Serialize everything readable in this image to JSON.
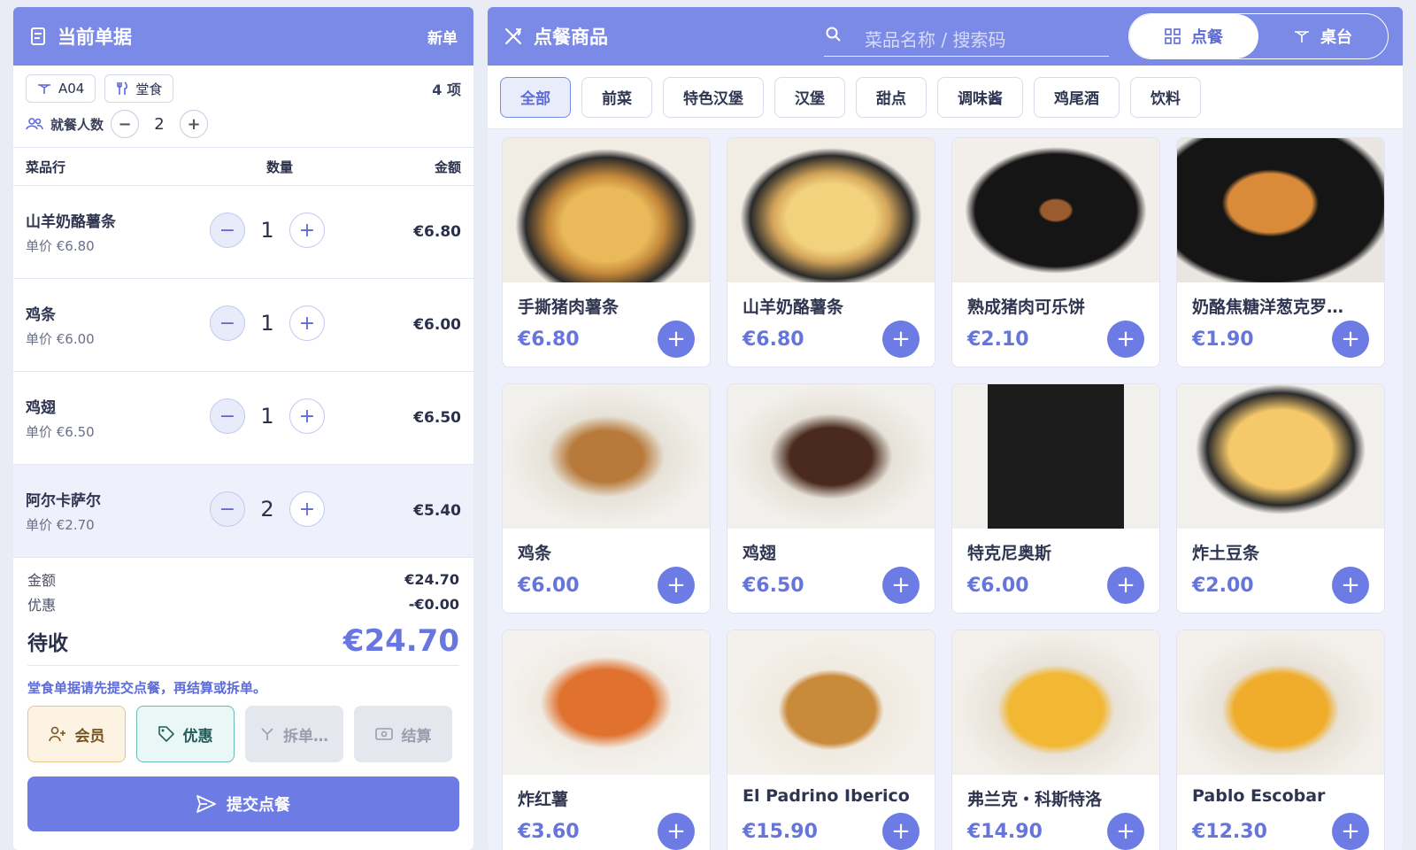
{
  "order": {
    "title": "当前单据",
    "new_label": "新单",
    "table": "A04",
    "mode": "堂食",
    "item_count": "4 项",
    "diners_label": "就餐人数",
    "diners": "2",
    "col_item": "菜品行",
    "col_qty": "数量",
    "col_amount": "金额",
    "items": [
      {
        "name": "山羊奶酪薯条",
        "unit": "单价 €6.80",
        "qty": "1",
        "amount": "€6.80"
      },
      {
        "name": "鸡条",
        "unit": "单价 €6.00",
        "qty": "1",
        "amount": "€6.00"
      },
      {
        "name": "鸡翅",
        "unit": "单价 €6.50",
        "qty": "1",
        "amount": "€6.50"
      },
      {
        "name": "阿尔卡萨尔",
        "unit": "单价 €2.70",
        "qty": "2",
        "amount": "€5.40"
      }
    ],
    "subtotal_label": "金额",
    "subtotal": "€24.70",
    "discount_label": "优惠",
    "discount": "-€0.00",
    "due_label": "待收",
    "due": "€24.70",
    "hint": "堂食单据请先提交点餐，再结算或拆单。",
    "actions": {
      "member": "会员",
      "discount": "优惠",
      "split": "拆单…",
      "pay": "结算"
    },
    "submit": "提交点餐"
  },
  "menu": {
    "title": "点餐商品",
    "search_placeholder": "菜品名称 / 搜索码",
    "mode_order": "点餐",
    "mode_table": "桌台",
    "categories": [
      "全部",
      "前菜",
      "特色汉堡",
      "汉堡",
      "甜点",
      "调味酱",
      "鸡尾酒",
      "饮料"
    ],
    "products": [
      {
        "name": "手撕猪肉薯条",
        "price": "€6.80"
      },
      {
        "name": "山羊奶酪薯条",
        "price": "€6.80"
      },
      {
        "name": "熟成猪肉可乐饼",
        "price": "€2.10"
      },
      {
        "name": "奶酪焦糖洋葱克罗…",
        "price": "€1.90"
      },
      {
        "name": "鸡条",
        "price": "€6.00"
      },
      {
        "name": "鸡翅",
        "price": "€6.50"
      },
      {
        "name": "特克尼奥斯",
        "price": "€6.00"
      },
      {
        "name": "炸土豆条",
        "price": "€2.00"
      },
      {
        "name": "炸红薯",
        "price": "€3.60"
      },
      {
        "name": "El Padrino Iberico",
        "price": "€15.90"
      },
      {
        "name": "弗兰克・科斯特洛",
        "price": "€14.90"
      },
      {
        "name": "Pablo Escobar",
        "price": "€12.30"
      }
    ]
  }
}
